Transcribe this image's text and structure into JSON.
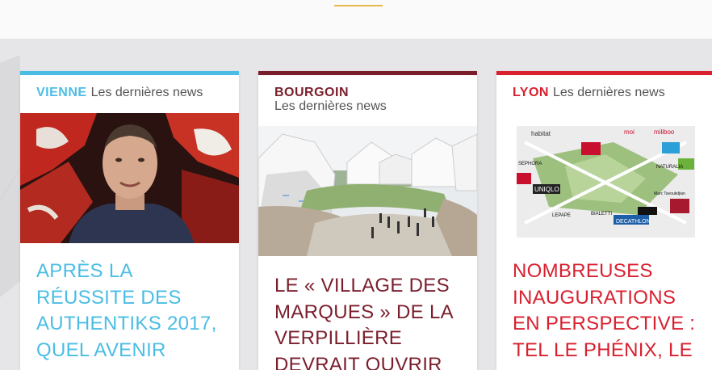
{
  "colors": {
    "vienne": "#4bbde4",
    "bourgoin": "#7a1e2c",
    "lyon": "#d8202f",
    "accent": "#e8b84a"
  },
  "cards": [
    {
      "city": "VIENNE",
      "subtitle": "Les dernières news",
      "title": "APRÈS LA RÉUSSITE DES AUTHENTIKS 2017, QUEL AVENIR",
      "image": "portrait-photo"
    },
    {
      "city": "BOURGOIN",
      "subtitle": "Les dernières news",
      "title": "LE « VILLAGE DES MARQUES » DE LA VERPILLIÈRE DEVRAIT OUVRIR",
      "image": "architecture-rendering"
    },
    {
      "city": "LYON",
      "subtitle": "Les dernières news",
      "title": "NOMBREUSES INAUGURATIONS EN PERSPECTIVE : TEL LE PHÉNIX, LE",
      "image": "shopping-map",
      "map_labels": [
        "habitat",
        "moi",
        "miliboo",
        "flying tiger copenhagen",
        "SEPHORA",
        "au 31 du cycle",
        "NATURALIA",
        "HEMA",
        "UNIQLO",
        "LEPAPE",
        "COURIR",
        "La Redoute",
        "BIALETTI",
        "Marc Tavoukdjian",
        "DECATHLON",
        "Hard Rock Cafe"
      ]
    }
  ]
}
